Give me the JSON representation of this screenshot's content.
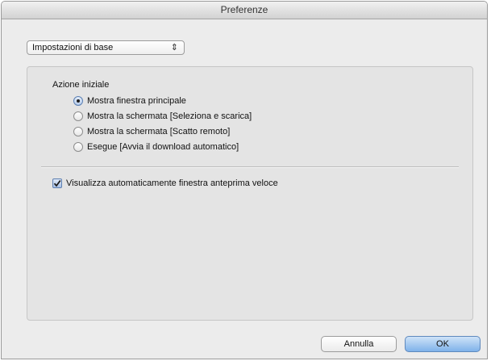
{
  "window": {
    "title": "Preferenze"
  },
  "category_select": {
    "selected": "Impostazioni di base",
    "icon": "updown-arrows-icon"
  },
  "panel": {
    "section_title": "Azione iniziale",
    "radio_options": [
      {
        "label": "Mostra finestra principale",
        "selected": true
      },
      {
        "label": "Mostra la schermata [Seleziona e scarica]",
        "selected": false
      },
      {
        "label": "Mostra la schermata [Scatto remoto]",
        "selected": false
      },
      {
        "label": "Esegue [Avvia il download automatico]",
        "selected": false
      }
    ],
    "checkbox": {
      "label": "Visualizza automaticamente finestra anteprima veloce",
      "checked": true
    }
  },
  "buttons": {
    "cancel": "Annulla",
    "ok": "OK"
  }
}
